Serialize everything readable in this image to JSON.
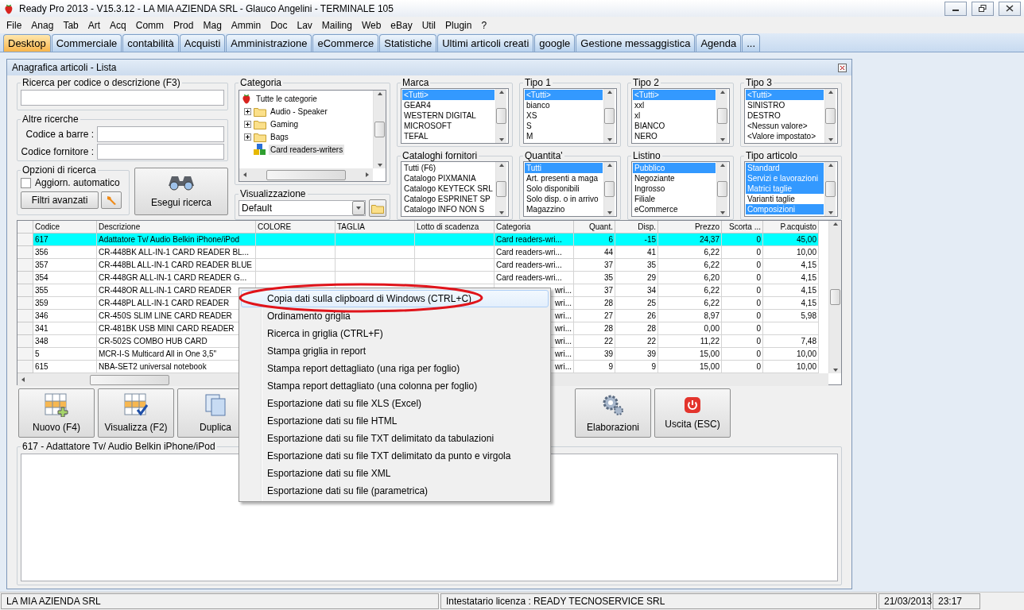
{
  "window": {
    "title": "Ready Pro 2013 - V15.3.12 - LA MIA AZIENDA SRL - Glauco Angelini - TERMINALE 105"
  },
  "menu": [
    "File",
    "Anag",
    "Tab",
    "Art",
    "Acq",
    "Comm",
    "Prod",
    "Mag",
    "Ammin",
    "Doc",
    "Lav",
    "Mailing",
    "Web",
    "eBay",
    "Util",
    "Plugin",
    "?"
  ],
  "tabs": [
    {
      "label": "Desktop",
      "selected": true
    },
    {
      "label": "Commerciale",
      "selected": false
    },
    {
      "label": "contabilità",
      "selected": false
    },
    {
      "label": "Acquisti",
      "selected": false
    },
    {
      "label": "Amministrazione",
      "selected": false
    },
    {
      "label": "eCommerce",
      "selected": false
    },
    {
      "label": "Statistiche",
      "selected": false
    },
    {
      "label": "Ultimi articoli creati",
      "selected": false
    },
    {
      "label": "google",
      "selected": false
    },
    {
      "label": "Gestione messaggistica",
      "selected": false
    },
    {
      "label": "Agenda",
      "selected": false
    },
    {
      "label": "...",
      "selected": false
    }
  ],
  "child_window": {
    "title": "Anagrafica articoli  - Lista"
  },
  "search": {
    "label": "Ricerca per codice o descrizione (F3)"
  },
  "other_searches": {
    "label": "Altre ricerche",
    "fields": [
      {
        "label": "Codice a barre :"
      },
      {
        "label": "Codice fornitore :"
      }
    ]
  },
  "options": {
    "label": "Opzioni di ricerca",
    "auto_update": {
      "label": "Aggiorn. automatico",
      "checked": false
    },
    "advanced_button": "Filtri avanzati"
  },
  "run_button": "Esegui ricerca",
  "category": {
    "label": "Categoria",
    "tree": [
      {
        "label": "Tutte le categorie",
        "kind": "root",
        "selected": false,
        "children": [
          {
            "label": "Audio - Speaker",
            "kind": "folder",
            "selected": false
          },
          {
            "label": "Gaming",
            "kind": "folder",
            "selected": false
          },
          {
            "label": "Bags",
            "kind": "folder",
            "selected": false
          },
          {
            "label": "Card readers-writers",
            "kind": "leaf",
            "selected": true
          }
        ]
      }
    ]
  },
  "view": {
    "label": "Visualizzazione",
    "value": "Default"
  },
  "filters": [
    {
      "label": "Marca",
      "items": [
        {
          "label": "<Tutti>",
          "selected": true
        },
        {
          "label": "GEAR4",
          "selected": false
        },
        {
          "label": "WESTERN DIGITAL",
          "selected": false
        },
        {
          "label": "MICROSOFT",
          "selected": false
        },
        {
          "label": "TEFAL",
          "selected": false
        }
      ]
    },
    {
      "label": "Tipo 1",
      "items": [
        {
          "label": "<Tutti>",
          "selected": true
        },
        {
          "label": "bianco",
          "selected": false
        },
        {
          "label": "XS",
          "selected": false
        },
        {
          "label": "S",
          "selected": false
        },
        {
          "label": "M",
          "selected": false
        }
      ]
    },
    {
      "label": "Tipo 2",
      "items": [
        {
          "label": "<Tutti>",
          "selected": true
        },
        {
          "label": "xxl",
          "selected": false
        },
        {
          "label": "xl",
          "selected": false
        },
        {
          "label": "BIANCO",
          "selected": false
        },
        {
          "label": "NERO",
          "selected": false
        }
      ]
    },
    {
      "label": "Tipo 3",
      "items": [
        {
          "label": "<Tutti>",
          "selected": true
        },
        {
          "label": "SINISTRO",
          "selected": false
        },
        {
          "label": "DESTRO",
          "selected": false
        },
        {
          "label": "<Nessun valore>",
          "selected": false
        },
        {
          "label": "<Valore impostato>",
          "selected": false
        }
      ]
    },
    {
      "label": "Cataloghi fornitori",
      "items": [
        {
          "label": "Tutti (F6)",
          "selected": false
        },
        {
          "label": "Catalogo PIXMANIA",
          "selected": false
        },
        {
          "label": "Catalogo KEYTECK SRL",
          "selected": false
        },
        {
          "label": "Catalogo ESPRINET SP",
          "selected": false
        },
        {
          "label": "Catalogo INFO NON S",
          "selected": false
        }
      ]
    },
    {
      "label": "Quantita'",
      "items": [
        {
          "label": "Tutti",
          "selected": true
        },
        {
          "label": "Art. presenti a maga",
          "selected": false
        },
        {
          "label": "Solo disponibili",
          "selected": false
        },
        {
          "label": "Solo disp. o in arrivo",
          "selected": false
        },
        {
          "label": "Magazzino",
          "selected": false
        }
      ]
    },
    {
      "label": "Listino",
      "items": [
        {
          "label": "Pubblico",
          "selected": true
        },
        {
          "label": "Negoziante",
          "selected": false
        },
        {
          "label": "Ingrosso",
          "selected": false
        },
        {
          "label": "Filiale",
          "selected": false
        },
        {
          "label": "eCommerce",
          "selected": false
        }
      ]
    },
    {
      "label": "Tipo articolo",
      "items": [
        {
          "label": "Standard",
          "selected": true
        },
        {
          "label": "Servizi e lavorazioni",
          "selected": true
        },
        {
          "label": "Matrici taglie",
          "selected": true
        },
        {
          "label": "Varianti taglie",
          "selected": false
        },
        {
          "label": "Composizioni",
          "selected": true
        }
      ]
    }
  ],
  "grid": {
    "columns": [
      "Codice",
      "Descrizione",
      "COLORE",
      "TAGLIA",
      "Lotto di scadenza",
      "Categoria",
      "Quant.",
      "Disp.",
      "Prezzo",
      "Scorta ...",
      "P.acquisto"
    ],
    "rows": [
      {
        "codice": "617",
        "descrizione": "Adattatore Tv/ Audio Belkin iPhone/iPod",
        "categoria": "Card readers-wri...",
        "quant": "6",
        "disp": "-15",
        "prezzo": "24,37",
        "scorta": "0",
        "p_acquisto": "45,00",
        "selected": true,
        "covered": false
      },
      {
        "codice": "356",
        "descrizione": "CR-448BK ALL-IN-1 CARD READER BL...",
        "categoria": "Card readers-wri...",
        "quant": "44",
        "disp": "41",
        "prezzo": "6,22",
        "scorta": "0",
        "p_acquisto": "10,00",
        "selected": false,
        "covered": false
      },
      {
        "codice": "357",
        "descrizione": "CR-448BL ALL-IN-1 CARD READER BLUE",
        "categoria": "Card readers-wri...",
        "quant": "37",
        "disp": "35",
        "prezzo": "6,22",
        "scorta": "0",
        "p_acquisto": "4,15",
        "selected": false,
        "covered": false
      },
      {
        "codice": "354",
        "descrizione": "CR-448GR ALL-IN-1 CARD READER G...",
        "categoria": "Card readers-wri...",
        "quant": "35",
        "disp": "29",
        "prezzo": "6,20",
        "scorta": "0",
        "p_acquisto": "4,15",
        "selected": false,
        "covered": false
      },
      {
        "codice": "355",
        "descrizione": "CR-448OR ALL-IN-1 CARD READER",
        "categoria": "wri...",
        "quant": "37",
        "disp": "34",
        "prezzo": "6,22",
        "scorta": "0",
        "p_acquisto": "4,15",
        "selected": false,
        "covered": true
      },
      {
        "codice": "359",
        "descrizione": "CR-448PL ALL-IN-1 CARD READER",
        "categoria": "wri...",
        "quant": "28",
        "disp": "25",
        "prezzo": "6,22",
        "scorta": "0",
        "p_acquisto": "4,15",
        "selected": false,
        "covered": true
      },
      {
        "codice": "346",
        "descrizione": "CR-450S SLIM LINE CARD READER",
        "categoria": "wri...",
        "quant": "27",
        "disp": "26",
        "prezzo": "8,97",
        "scorta": "0",
        "p_acquisto": "5,98",
        "selected": false,
        "covered": true
      },
      {
        "codice": "341",
        "descrizione": "CR-481BK USB MINI CARD READER",
        "categoria": "wri...",
        "quant": "28",
        "disp": "28",
        "prezzo": "0,00",
        "scorta": "0",
        "selected": false,
        "covered": true
      },
      {
        "codice": "348",
        "descrizione": "CR-502S COMBO HUB CARD",
        "categoria": "wri...",
        "quant": "22",
        "disp": "22",
        "prezzo": "11,22",
        "scorta": "0",
        "p_acquisto": "7,48",
        "selected": false,
        "covered": true
      },
      {
        "codice": "5",
        "descrizione": "MCR-I-S Multicard All in One 3,5\"",
        "categoria": "wri...",
        "quant": "39",
        "disp": "39",
        "prezzo": "15,00",
        "scorta": "0",
        "p_acquisto": "10,00",
        "selected": false,
        "covered": true
      },
      {
        "codice": "615",
        "descrizione": "NBA-SET2 universal notebook",
        "categoria": "wri...",
        "quant": "9",
        "disp": "9",
        "prezzo": "15,00",
        "scorta": "0",
        "p_acquisto": "10,00",
        "selected": false,
        "covered": true
      }
    ]
  },
  "toolbar": {
    "left": [
      {
        "label": "Nuovo (F4)",
        "kind": "new"
      },
      {
        "label": "Visualizza (F2)",
        "kind": "view"
      },
      {
        "label": "Duplica",
        "kind": "copy"
      }
    ],
    "right": [
      {
        "label": "Elaborazioni",
        "kind": "gears"
      },
      {
        "label": "Uscita (ESC)",
        "kind": "exit"
      }
    ]
  },
  "detail": {
    "label": "617 - Adattatore Tv/ Audio Belkin iPhone/iPod"
  },
  "context_menu": {
    "items": [
      {
        "label": "Copia dati sulla clipboard di Windows (CTRL+C)",
        "selected": true
      },
      {
        "label": "Ordinamento griglia",
        "selected": false
      },
      {
        "label": "Ricerca in griglia (CTRL+F)",
        "selected": false
      },
      {
        "label": "Stampa griglia in report",
        "selected": false
      },
      {
        "label": "Stampa report dettagliato (una riga per foglio)",
        "selected": false
      },
      {
        "label": "Stampa report dettagliato (una colonna per foglio)",
        "selected": false
      },
      {
        "label": "Esportazione dati su file XLS (Excel)",
        "selected": false
      },
      {
        "label": "Esportazione dati su file HTML",
        "selected": false
      },
      {
        "label": "Esportazione dati su file TXT delimitato da tabulazioni",
        "selected": false
      },
      {
        "label": "Esportazione dati su file TXT delimitato da punto e virgola",
        "selected": false
      },
      {
        "label": "Esportazione dati su file XML",
        "selected": false
      },
      {
        "label": "Esportazione dati su file (parametrica)",
        "selected": false
      }
    ]
  },
  "status_bar": [
    "LA MIA AZIENDA SRL",
    "Intestatario licenza : READY TECNOSERVICE SRL",
    "21/03/2013",
    "23:17"
  ]
}
